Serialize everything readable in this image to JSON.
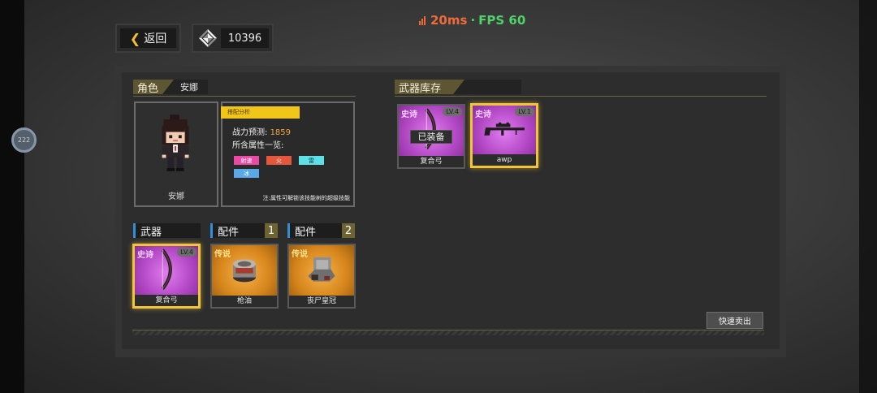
{
  "status": {
    "ping": "20ms",
    "separator": "·",
    "fps": "FPS 60",
    "float_ball": "222"
  },
  "topbar": {
    "back_label": "返回",
    "currency_value": "10396"
  },
  "character": {
    "section_title": "角色",
    "name_tab": "安娜",
    "card_name": "安娜",
    "badge": "搭配分析",
    "power_label": "战力预测:",
    "power_value": "1859",
    "attributes_label": "所含属性一览:",
    "attributes": [
      {
        "label": "射速",
        "color": "#e94aa6"
      },
      {
        "label": "火",
        "color": "#e4573d"
      },
      {
        "label": "雷",
        "color": "#5de0e6"
      },
      {
        "label": "冰",
        "color": "#5aa8e8"
      }
    ],
    "note": "注:属性可解锁该技能树的超级技能"
  },
  "slots": {
    "weapon_label": "武器",
    "acc1_label": "配件",
    "acc1_num": "1",
    "acc2_label": "配件",
    "acc2_num": "2",
    "weapon": {
      "rarity": "史诗",
      "level": "LV.4",
      "name": "复合弓",
      "icon": "bow-icon"
    },
    "acc1": {
      "rarity": "传说",
      "name": "枪油",
      "icon": "gun-oil-can-icon"
    },
    "acc2": {
      "rarity": "传说",
      "name": "丧尸皇冠",
      "icon": "zombie-crown-icon"
    }
  },
  "inventory": {
    "section_title": "武器库存",
    "items": [
      {
        "rarity": "史诗",
        "level": "LV.4",
        "name": "复合弓",
        "equipped_label": "已装备",
        "icon": "bow-icon"
      },
      {
        "rarity": "史诗",
        "level": "LV.1",
        "name": "awp",
        "icon": "sniper-rifle-icon"
      }
    ],
    "quick_sell": "快速卖出"
  },
  "colors": {
    "epic": "#b247c4",
    "legendary": "#d6851c",
    "selection": "#f2c43a",
    "accent_tag": "#5e5633"
  }
}
